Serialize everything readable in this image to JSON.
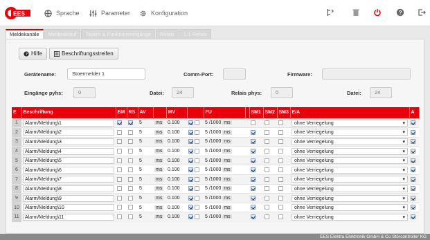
{
  "logo_text": "EES",
  "nav": {
    "language": "Sprache",
    "parameters": "Parameter",
    "configuration": "Konfiguration"
  },
  "tools": [
    "reorder-icon",
    "trash-icon",
    "power-icon",
    "help-icon",
    "logout-icon"
  ],
  "tabs": [
    "Meldekanäle",
    "Meldeablauf",
    "Tasten & Funktionseingänge",
    "Relais",
    "1:1-Relais"
  ],
  "toolbar": {
    "help": "Hilfe",
    "label_strips": "Beschriftungsstreifen"
  },
  "info": {
    "device_name_label": "Gerätename:",
    "device_name_value": "Stoermelder 1",
    "comm_port_label": "Comm-Port:",
    "comm_port_value": "",
    "firmware_label": "Firmware:",
    "firmware_value": "",
    "inputs_phys_label": "Eingänge pyhs:",
    "inputs_phys_value": "0",
    "file1_label": "Datei:",
    "file1_value": "24",
    "relays_phys_label": "Relais phys:",
    "relays_phys_value": "0",
    "file2_label": "Datei:",
    "file2_value": "24"
  },
  "table": {
    "headers": [
      "E",
      "Beschriftung",
      "BM",
      "RS",
      "AV",
      "",
      "MV",
      "",
      "FU",
      "",
      "SM1",
      "SM2",
      "SM3",
      "E/A",
      "A"
    ],
    "unit_ms": "ms",
    "fu_divisor": "/1000",
    "rows": [
      {
        "n": "1",
        "label": "Alarm/Meldung\\1",
        "bm": true,
        "rs": true,
        "av": "5",
        "mv": "0.100",
        "mv1": true,
        "mv2": false,
        "fu": "5",
        "sm1": false,
        "sm2": false,
        "sm3": false,
        "mode": "ohne Verriegelung",
        "a": true
      },
      {
        "n": "2",
        "label": "Alarm/Meldung\\2",
        "bm": false,
        "rs": false,
        "av": "5",
        "mv": "0.100",
        "mv1": true,
        "mv2": false,
        "fu": "5",
        "sm1": true,
        "sm2": false,
        "sm3": false,
        "mode": "ohne Verriegelung",
        "a": true
      },
      {
        "n": "3",
        "label": "Alarm/Meldung\\3",
        "bm": false,
        "rs": false,
        "av": "5",
        "mv": "0.100",
        "mv1": true,
        "mv2": false,
        "fu": "5",
        "sm1": true,
        "sm2": false,
        "sm3": false,
        "mode": "ohne Verriegelung",
        "a": true
      },
      {
        "n": "4",
        "label": "Alarm/Meldung\\4",
        "bm": false,
        "rs": false,
        "av": "5",
        "mv": "0.100",
        "mv1": true,
        "mv2": false,
        "fu": "5",
        "sm1": true,
        "sm2": false,
        "sm3": false,
        "mode": "ohne Verriegelung",
        "a": true
      },
      {
        "n": "5",
        "label": "Alarm/Meldung\\5",
        "bm": false,
        "rs": false,
        "av": "5",
        "mv": "0.100",
        "mv1": true,
        "mv2": false,
        "fu": "5",
        "sm1": true,
        "sm2": false,
        "sm3": false,
        "mode": "ohne Verriegelung",
        "a": true
      },
      {
        "n": "6",
        "label": "Alarm/Meldung\\6",
        "bm": false,
        "rs": false,
        "av": "5",
        "mv": "0.100",
        "mv1": true,
        "mv2": false,
        "fu": "5",
        "sm1": true,
        "sm2": false,
        "sm3": false,
        "mode": "ohne Verriegelung",
        "a": true
      },
      {
        "n": "7",
        "label": "Alarm/Meldung\\7",
        "bm": false,
        "rs": false,
        "av": "5",
        "mv": "0.100",
        "mv1": true,
        "mv2": false,
        "fu": "5",
        "sm1": true,
        "sm2": false,
        "sm3": false,
        "mode": "ohne Verriegelung",
        "a": true
      },
      {
        "n": "8",
        "label": "Alarm/Meldung\\8",
        "bm": false,
        "rs": false,
        "av": "5",
        "mv": "0.100",
        "mv1": true,
        "mv2": false,
        "fu": "5",
        "sm1": true,
        "sm2": false,
        "sm3": false,
        "mode": "ohne Verriegelung",
        "a": true
      },
      {
        "n": "9",
        "label": "Alarm/Meldung\\9",
        "bm": false,
        "rs": false,
        "av": "5",
        "mv": "0.100",
        "mv1": true,
        "mv2": false,
        "fu": "5",
        "sm1": true,
        "sm2": false,
        "sm3": false,
        "mode": "ohne Verriegelung",
        "a": true
      },
      {
        "n": "10",
        "label": "Alarm/Meldung\\10",
        "bm": false,
        "rs": false,
        "av": "5",
        "mv": "0.100",
        "mv1": true,
        "mv2": false,
        "fu": "5",
        "sm1": true,
        "sm2": false,
        "sm3": false,
        "mode": "ohne Verriegelung",
        "a": true
      },
      {
        "n": "11",
        "label": "Alarm/Meldung\\11",
        "bm": false,
        "rs": false,
        "av": "5",
        "mv": "0.100",
        "mv1": true,
        "mv2": false,
        "fu": "5",
        "sm1": true,
        "sm2": false,
        "sm3": false,
        "mode": "ohne Verriegelung",
        "a": true
      }
    ]
  },
  "footer": "EES Elektra Elektronik GmbH & Co Störcontroller KG",
  "colors": {
    "accent": "#e8000b",
    "header_bg": "#e8000b",
    "footer_bg": "#8a8a8a"
  }
}
